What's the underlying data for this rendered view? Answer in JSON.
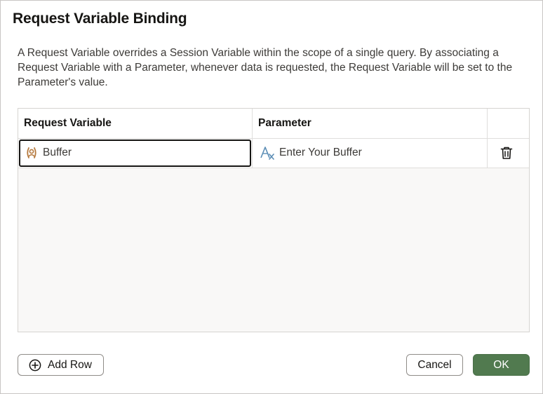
{
  "dialog": {
    "title": "Request Variable Binding",
    "description": "A Request Variable overrides a Session Variable within the scope of a single query. By associating a Request Variable with a Parameter, whenever data is requested, the Request Variable will be set to the Parameter's value."
  },
  "table": {
    "columns": [
      "Request Variable",
      "Parameter",
      ""
    ],
    "rows": [
      {
        "request_variable": "Buffer",
        "variable_icon": "user-variable-icon",
        "parameter": "Enter Your Buffer",
        "parameter_icon": "text-parameter-icon",
        "action_icon": "trash-icon"
      }
    ]
  },
  "footer": {
    "add_row_label": "Add Row",
    "cancel_label": "Cancel",
    "ok_label": "OK"
  },
  "colors": {
    "primary": "#517a4f",
    "variable_icon": "#b5793d",
    "parameter_icon": "#5b8db5"
  }
}
